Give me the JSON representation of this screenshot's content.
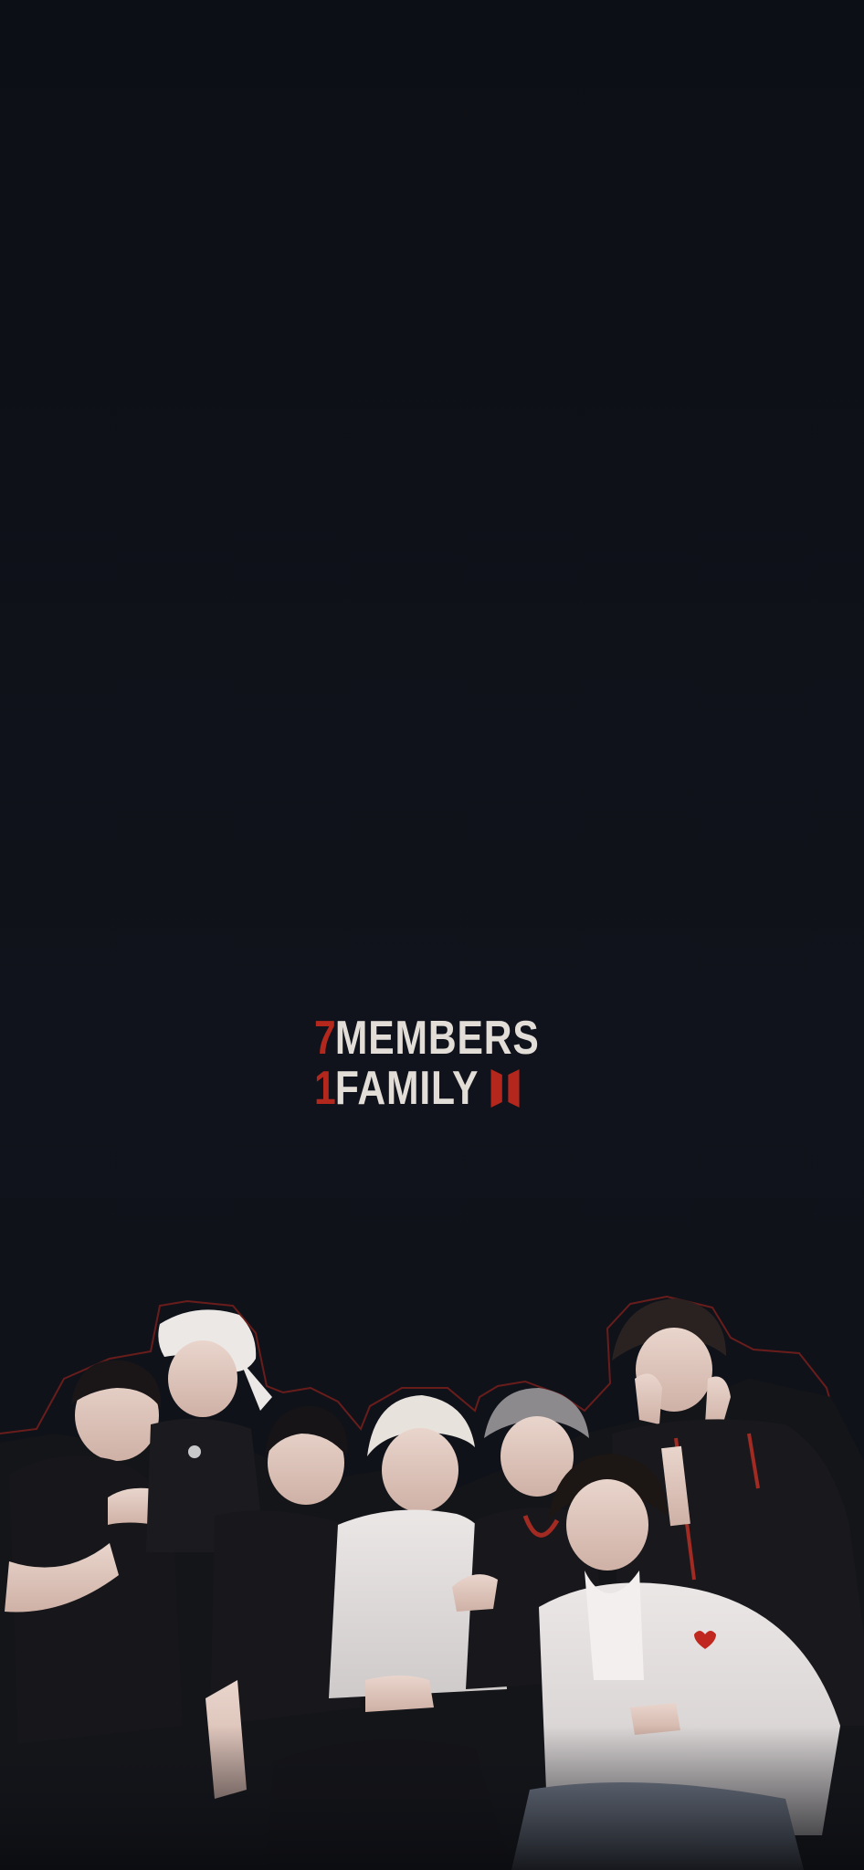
{
  "slogan": {
    "line1": {
      "number": "7",
      "word": "MEMBERS"
    },
    "line2": {
      "number": "1",
      "word": "FAMILY"
    },
    "logo_icon": "bts-emblem-icon"
  },
  "photo": {
    "subject": "group-of-seven-people-photo",
    "outline_color": "#b3271d"
  },
  "colors": {
    "background": "#0f1118",
    "accent_red": "#b3271d",
    "text_light": "#e3ddd8"
  }
}
